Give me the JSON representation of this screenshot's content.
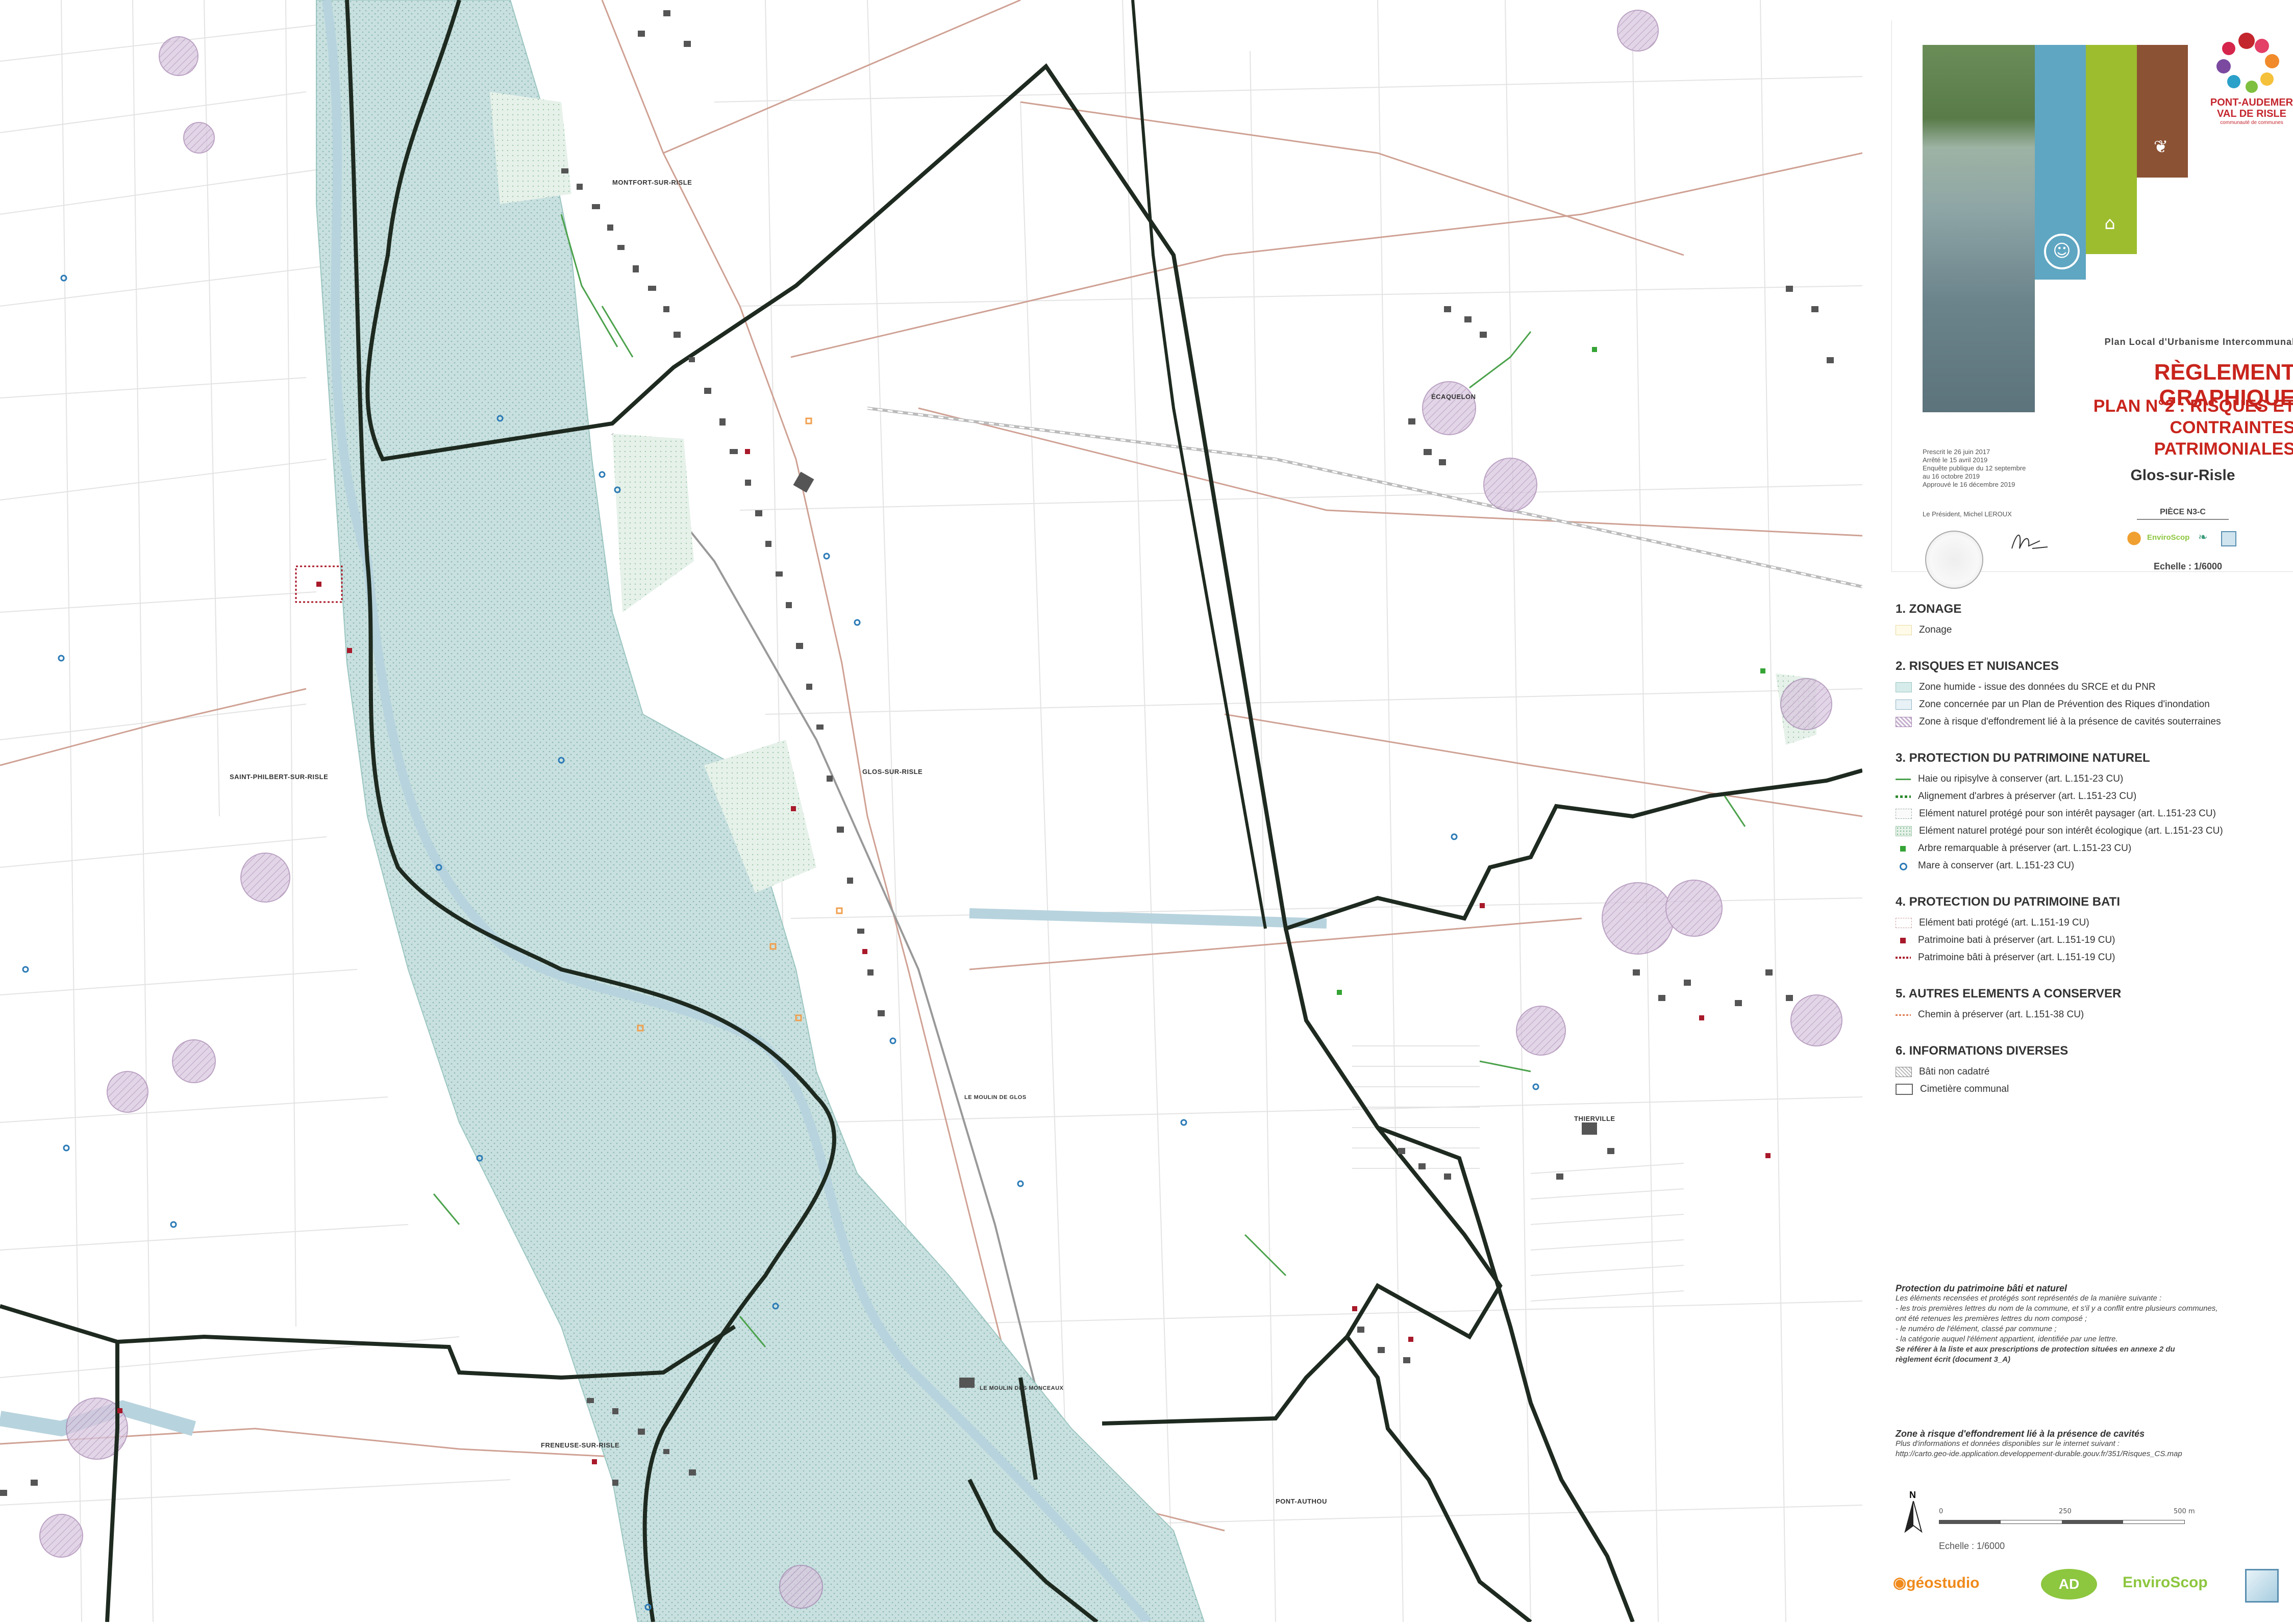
{
  "map": {
    "place_labels": [
      "MONTFORT-SUR-RISLE",
      "SAINT-PHILBERT-SUR-RISLE",
      "GLOS-SUR-RISLE",
      "ÉCAQUELON",
      "THIERVILLE",
      "FRENEUSE-SUR-RISLE",
      "PONT-AUTHOU",
      "LE MOULIN DE GLOS",
      "LE MOULIN DES MONCEAUX"
    ],
    "colors": {
      "wetland": "#c8e0df",
      "wetland_dots": "#8bb8b4",
      "river": "#b7d3de",
      "commune_boundary": "#1e2a20",
      "parcel": "#e3e3e3",
      "road": "#cfa194",
      "cavity": "#b99dc3",
      "building": "#555555"
    }
  },
  "header": {
    "logo_line1": "PONT-AUDEMER",
    "logo_line2": "VAL DE RISLE",
    "logo_line3": "communauté de communes",
    "plan_title": "Plan Local d'Urbanisme Intercommunal",
    "reg_title": "RÈGLEMENT GRAPHIQUE",
    "sub_title_1": "PLAN N°2 : RISQUES ET",
    "sub_title_2": "CONTRAINTES PATRIMONIALES",
    "commune": "Glos-sur-Risle",
    "piece": "PIÈCE N3-C",
    "echelle": "Echelle : 1/6000",
    "dates": [
      "Prescrit le 26 juin 2017",
      "Arrêté le 15 avril 2019",
      "Enquête publique du 12 septembre",
      "au 16 octobre 2019",
      "Approuvé le 16 décembre 2019"
    ],
    "president": "Le Président, Michel LEROUX",
    "mini_logo_1": "EnviroScop"
  },
  "legend": {
    "s1": {
      "title": "1. ZONAGE",
      "items": [
        "Zonage"
      ]
    },
    "s2": {
      "title": "2. RISQUES ET NUISANCES",
      "items": [
        "Zone humide - issue des données du SRCE et du PNR",
        "Zone concernée par un Plan de Prévention des Riques d'inondation",
        "Zone à risque d'effondrement lié à la présence de cavités souterraines"
      ]
    },
    "s3": {
      "title": "3. PROTECTION DU PATRIMOINE NATUREL",
      "items": [
        "Haie ou ripisylve à conserver (art. L.151-23 CU)",
        "Alignement d'arbres à préserver (art. L.151-23 CU)",
        "Elément naturel protégé pour son intérêt paysager (art. L.151-23 CU)",
        "Elément naturel protégé pour son intérêt écologique (art. L.151-23 CU)",
        "Arbre remarquable à préserver (art. L.151-23 CU)",
        "Mare à conserver (art. L.151-23 CU)"
      ]
    },
    "s4": {
      "title": "4. PROTECTION DU PATRIMOINE BATI",
      "items": [
        "Elément bati protégé (art. L.151-19 CU)",
        "Patrimoine bati à préserver (art. L.151-19 CU)",
        "Patrimoine bâti à préserver (art. L.151-19 CU)"
      ]
    },
    "s5": {
      "title": "5. AUTRES ELEMENTS A CONSERVER",
      "items": [
        "Chemin à préserver (art. L.151-38 CU)"
      ]
    },
    "s6": {
      "title": "6. INFORMATIONS DIVERSES",
      "items": [
        "Bâti non cadatré",
        "Cimetière communal"
      ]
    }
  },
  "notes": {
    "title": "Protection du patrimoine bâti et naturel",
    "l1": "Les éléments recensées et protégés sont représentés de la manière suivante :",
    "l2": "- les trois premières lettres du nom de la commune, et s'il y a conflit entre plusieurs communes,",
    "l3": "ont été retenues les premières lettres du nom composé ;",
    "l4": "- le numéro de l'élément, classé par commune ;",
    "l5": "- la catégorie auquel l'élément appartient, identifiée par une lettre.",
    "l6": "Se référer à la liste et aux prescriptions de protection situées en annexe 2 du",
    "l7": "règlement écrit (document 3_A)"
  },
  "cavities": {
    "title": "Zone à risque d'effondrement lié à la présence de cavités",
    "l1": "Plus d'informations et données disponibles sur le internet suivant :",
    "l2": "http://carto.geo-ide.application.developpement-durable.gouv.fr/351/Risques_CS.map"
  },
  "scale": {
    "north": "N",
    "t0": "0",
    "t1": "250",
    "t2": "500 m",
    "label": "Echelle : 1/6000"
  },
  "footer_logos": {
    "geostudio": "géostudio",
    "ad": "AD",
    "enviroscop": "EnviroScop"
  }
}
